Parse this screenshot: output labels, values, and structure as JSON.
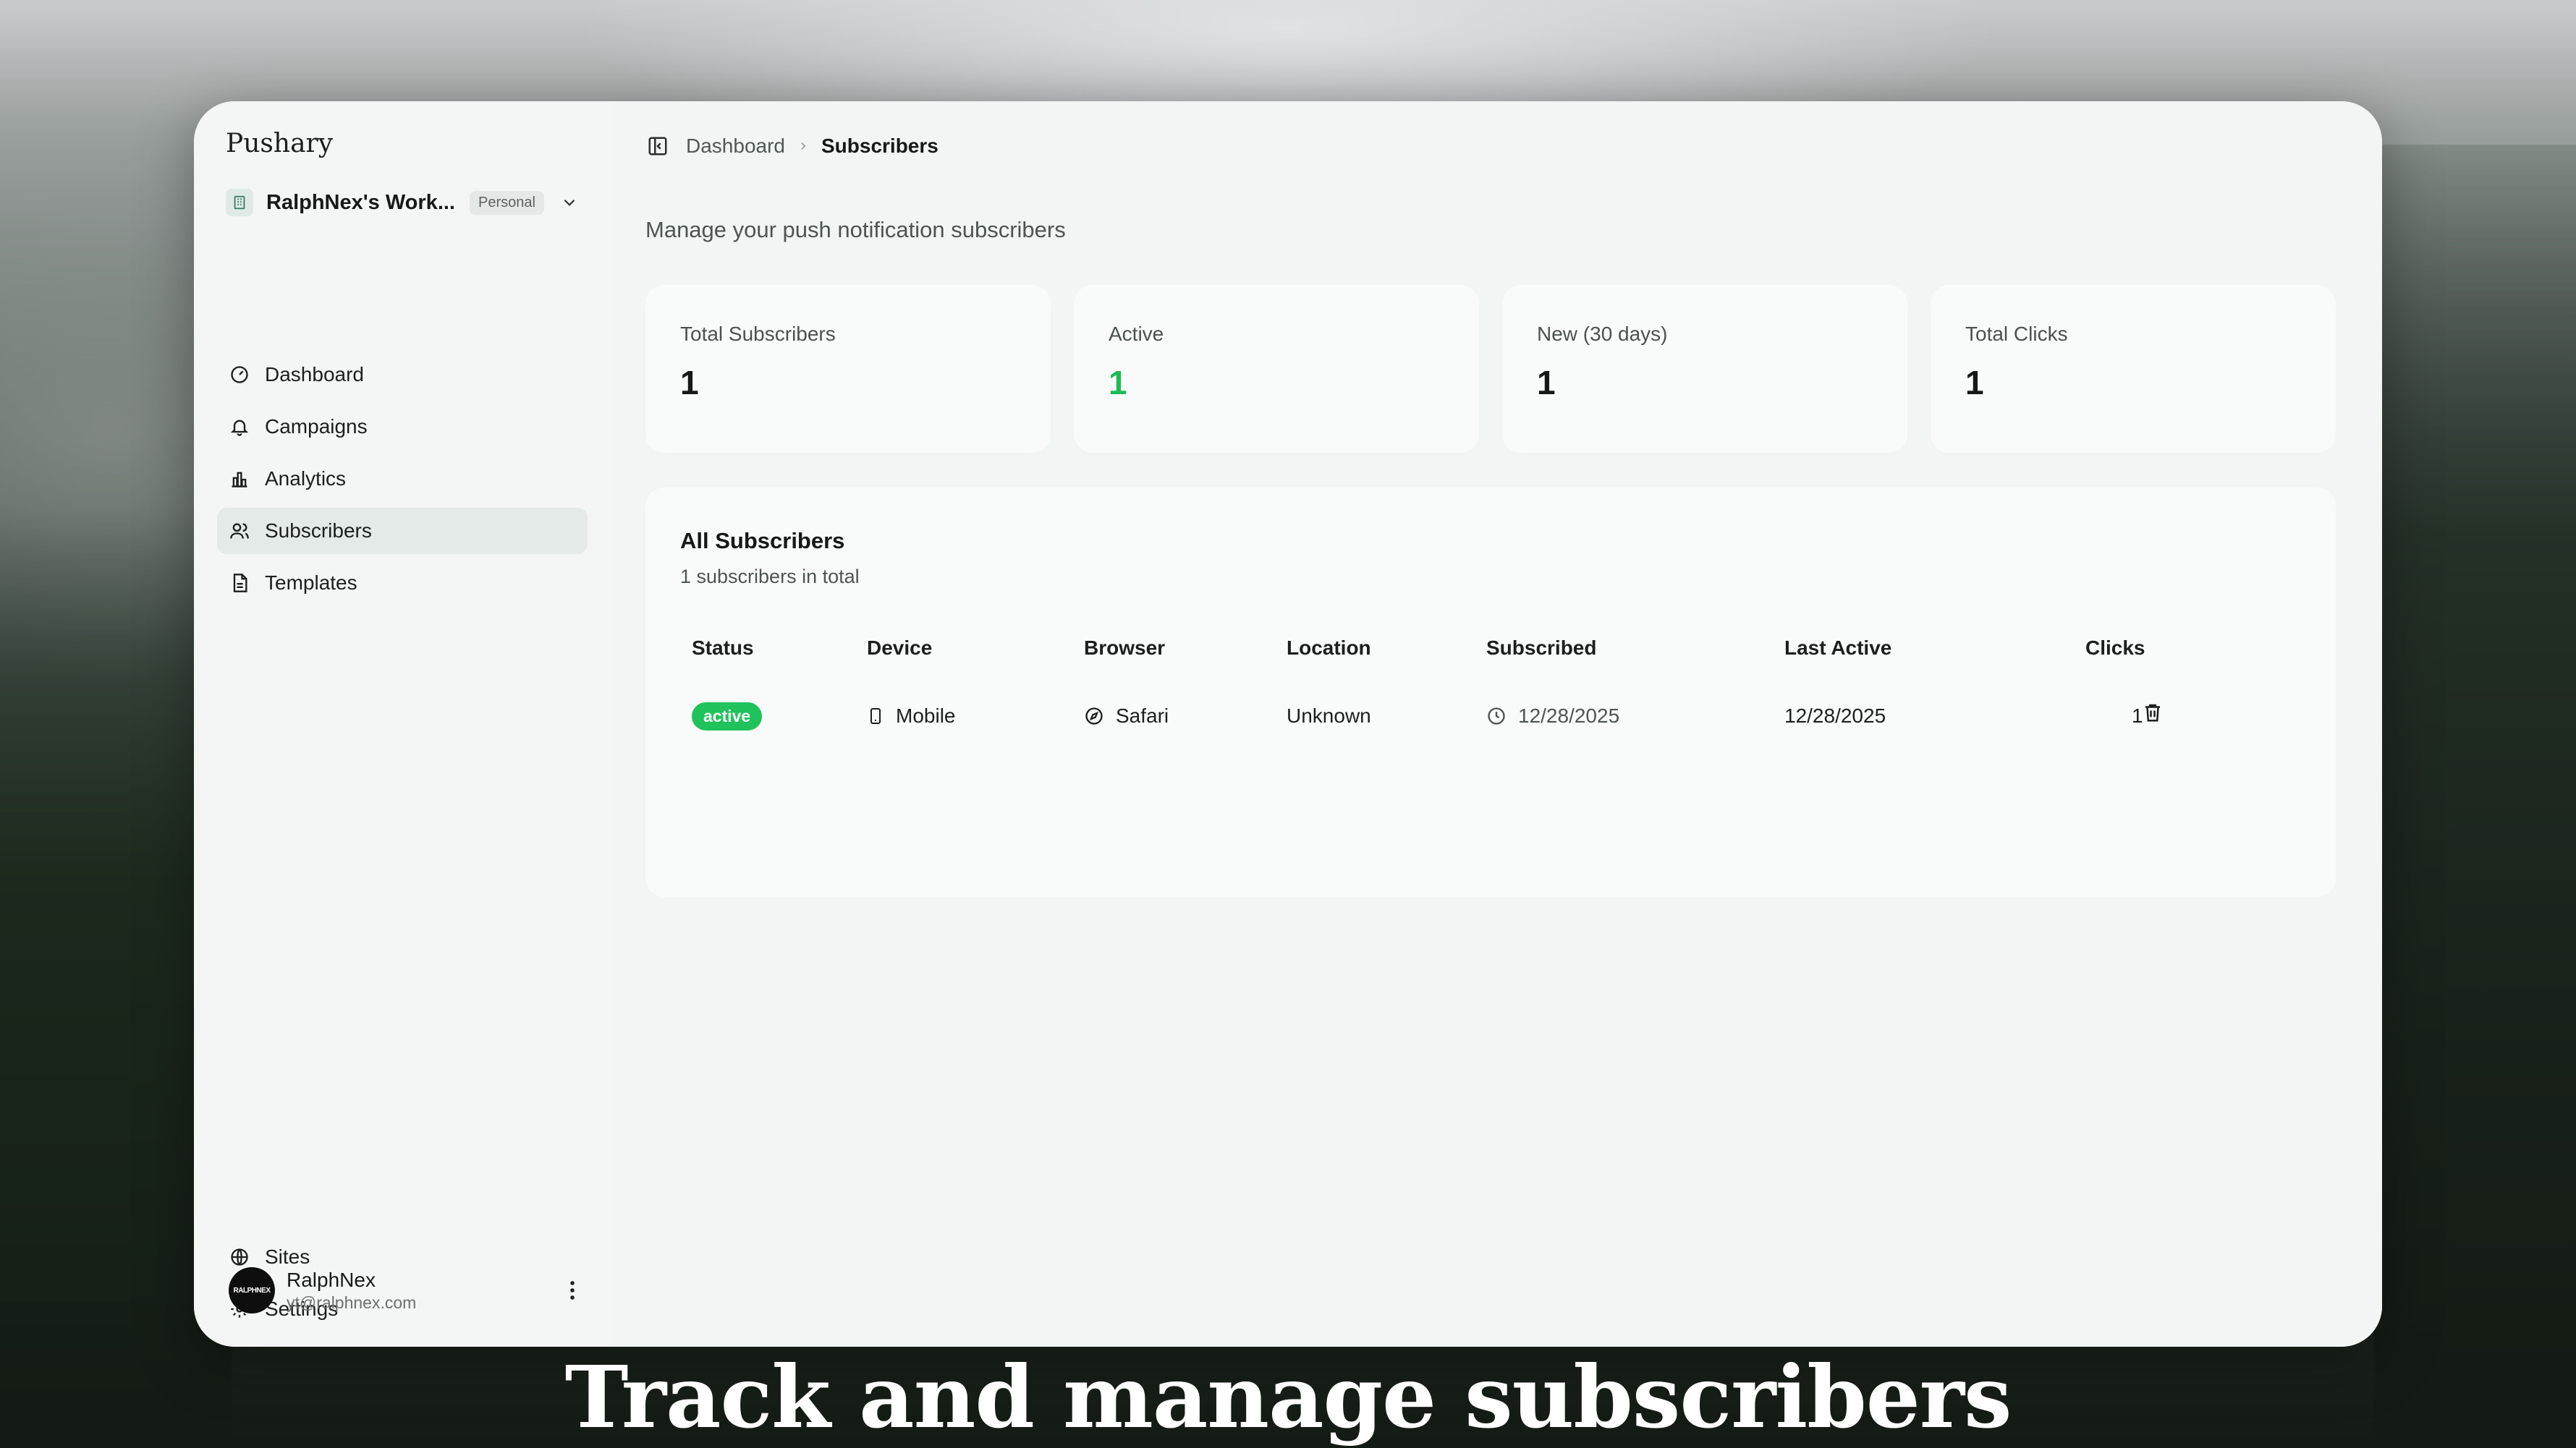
{
  "caption": "Track and manage subscribers",
  "sidebar": {
    "brand": "Pushary",
    "workspace": {
      "name": "RalphNex's Work...",
      "badge": "Personal"
    },
    "nav": [
      {
        "label": "Dashboard",
        "icon": "gauge-icon"
      },
      {
        "label": "Campaigns",
        "icon": "bell-icon"
      },
      {
        "label": "Analytics",
        "icon": "bar-chart-icon"
      },
      {
        "label": "Subscribers",
        "icon": "users-icon",
        "active": true
      },
      {
        "label": "Templates",
        "icon": "file-text-icon"
      }
    ],
    "bottom_nav": [
      {
        "label": "Sites",
        "icon": "globe-icon"
      },
      {
        "label": "Settings",
        "icon": "gear-icon"
      }
    ],
    "user": {
      "name": "RalphNex",
      "email": "yt@ralphnex.com",
      "avatar_text": "RALPHNEX"
    }
  },
  "header": {
    "breadcrumb": {
      "parent": "Dashboard",
      "current": "Subscribers"
    },
    "subtitle": "Manage your push notification subscribers"
  },
  "stats": [
    {
      "label": "Total Subscribers",
      "value": "1"
    },
    {
      "label": "Active",
      "value": "1",
      "color": "#1fb955"
    },
    {
      "label": "New (30 days)",
      "value": "1"
    },
    {
      "label": "Total Clicks",
      "value": "1"
    }
  ],
  "table": {
    "title": "All Subscribers",
    "subtitle": "1 subscribers in total",
    "columns": [
      "Status",
      "Device",
      "Browser",
      "Location",
      "Subscribed",
      "Last Active",
      "Clicks"
    ],
    "rows": [
      {
        "status": "active",
        "device": "Mobile",
        "browser": "Safari",
        "location": "Unknown",
        "subscribed": "12/28/2025",
        "last_active": "12/28/2025",
        "clicks": "1"
      }
    ]
  },
  "colors": {
    "accent_green": "#1fc25b",
    "window_bg": "#f4f6f5"
  }
}
